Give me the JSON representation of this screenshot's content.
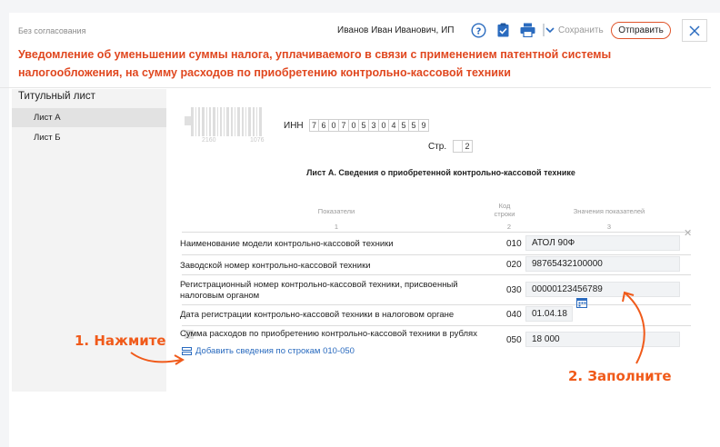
{
  "header": {
    "status": "Без согласования",
    "user_name": "Иванов Иван Иванович, ИП",
    "save_label": "Сохранить",
    "send_label": "Отправить",
    "accent_color": "#e0471f"
  },
  "form_title": "Уведомление об уменьшении суммы налога, уплачиваемого в связи с применением патентной системы налогообложения, на сумму расходов по приобретению контрольно-кассовой техники",
  "sidebar": {
    "heading": "Титульный лист",
    "items": [
      {
        "label": "Лист А",
        "active": true
      },
      {
        "label": "Лист Б",
        "active": false
      }
    ]
  },
  "document": {
    "barcode_numbers": [
      "2160",
      "1076"
    ],
    "inn_label": "ИНН",
    "inn_digits": [
      "7",
      "6",
      "0",
      "7",
      "0",
      "5",
      "3",
      "0",
      "4",
      "5",
      "5",
      "9"
    ],
    "page_label": "Стр.",
    "page_digits": [
      "",
      "2"
    ],
    "sheet_title": "Лист А. Сведения о приобретенной контрольно-кассовой технике",
    "columns": {
      "indicators": "Показатели",
      "code": "Код строки",
      "values": "Значения показателей",
      "num1": "1",
      "num2": "2",
      "num3": "3"
    },
    "rows": [
      {
        "label": "Наименование модели контрольно-кассовой техники",
        "code": "010",
        "value": "АТОЛ 90Ф"
      },
      {
        "label": "Заводской номер контрольно-кассовой техники",
        "code": "020",
        "value": "98765432100000"
      },
      {
        "label": "Регистрационный номер контрольно-кассовой техники, присвоенный налоговым органом",
        "code": "030",
        "value": "00000123456789"
      },
      {
        "label": "Дата регистрации контрольно-кассовой техники в налоговом органе",
        "code": "040",
        "value": "01.04.18"
      },
      {
        "label": "Сумма расходов по приобретению контрольно-кассовой техники в рублях",
        "code": "050",
        "value": "18 000"
      }
    ],
    "add_link": "Добавить сведения по строкам 010-050"
  },
  "annotations": {
    "step1": "1. Нажмите",
    "step2": "2. Заполните",
    "color": "#f05a1a"
  },
  "icons": [
    "help-icon",
    "clipboard-icon",
    "printer-icon",
    "chevron-down-icon",
    "close-icon",
    "calendar-icon",
    "add-rows-icon"
  ]
}
